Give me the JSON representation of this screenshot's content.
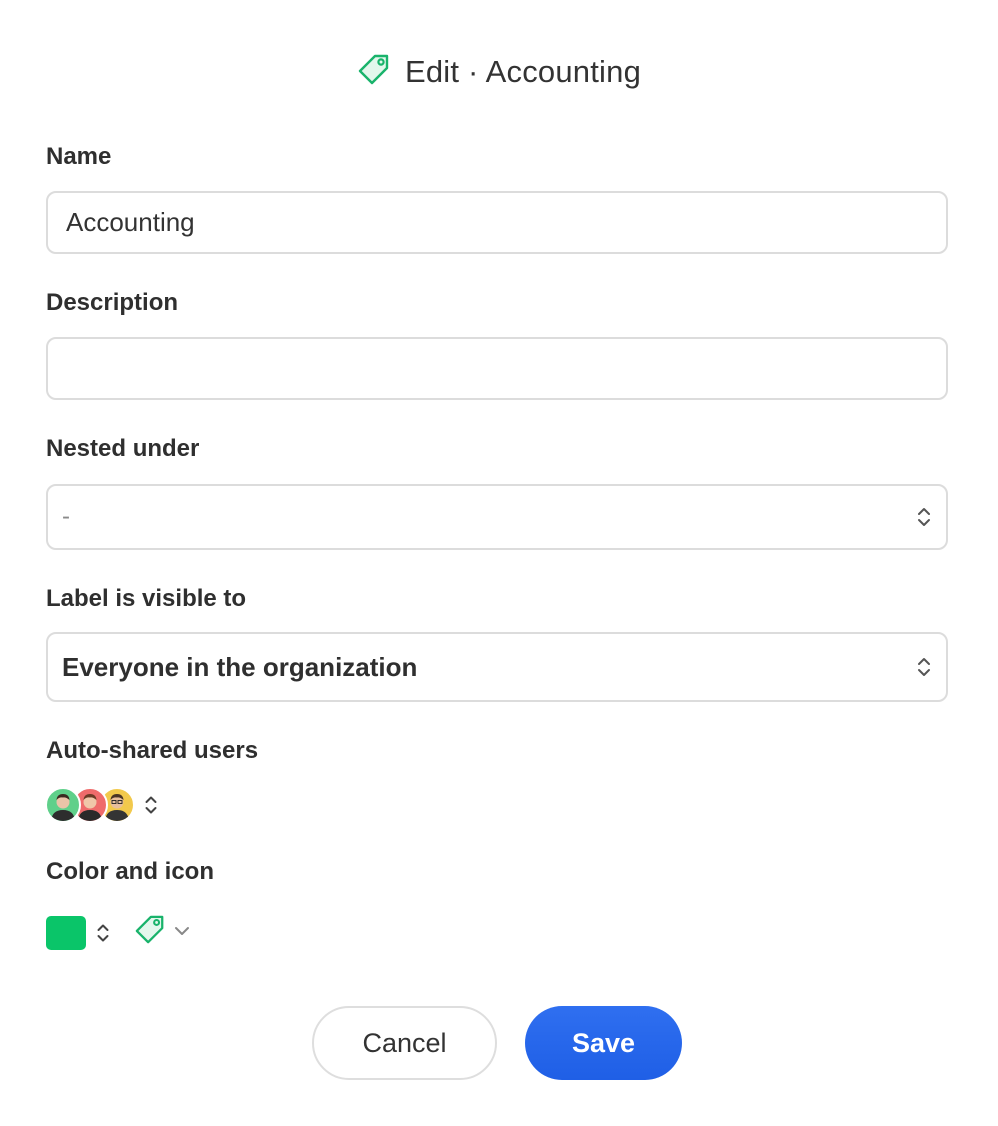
{
  "dialog": {
    "title": "Edit · Accounting",
    "icon": "tag-icon",
    "accent_color": "#19b36b"
  },
  "fields": {
    "name": {
      "label": "Name",
      "value": "Accounting"
    },
    "description": {
      "label": "Description",
      "value": ""
    },
    "nested_under": {
      "label": "Nested under",
      "value": "-"
    },
    "visibility": {
      "label": "Label is visible to",
      "value": "Everyone in the organization"
    },
    "auto_shared": {
      "label": "Auto-shared users",
      "avatars": [
        {
          "ring_color": "#5fd08a"
        },
        {
          "ring_color": "#ef6b6b"
        },
        {
          "ring_color": "#f2c94c"
        }
      ]
    },
    "color_icon": {
      "label": "Color and icon",
      "color": "#0ac569",
      "icon": "tag-icon"
    }
  },
  "actions": {
    "cancel_label": "Cancel",
    "save_label": "Save",
    "save_color": "#2563eb"
  }
}
